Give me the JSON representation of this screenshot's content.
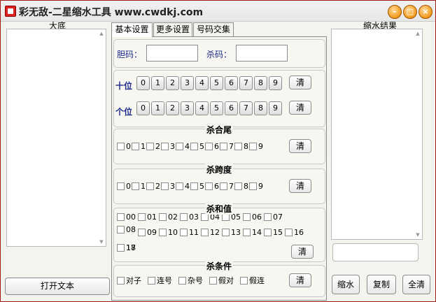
{
  "window": {
    "title": "彩无敌-二星缩水工具 www.cwdkj.com"
  },
  "left_panel": {
    "title": "大底",
    "open_button": "打开文本"
  },
  "tabs": [
    "基本设置",
    "更多设置",
    "号码交集"
  ],
  "basic": {
    "dan_label": "胆码：",
    "sha_label": "杀码：",
    "ten_label": "十位",
    "one_label": "个位",
    "digits": [
      "0",
      "1",
      "2",
      "3",
      "4",
      "5",
      "6",
      "7",
      "8",
      "9"
    ],
    "clear": "清"
  },
  "groups": {
    "tail": {
      "title": "杀合尾",
      "options": [
        "0",
        "1",
        "2",
        "3",
        "4",
        "5",
        "6",
        "7",
        "8",
        "9"
      ]
    },
    "span": {
      "title": "杀跨度",
      "options": [
        "0",
        "1",
        "2",
        "3",
        "4",
        "5",
        "6",
        "7",
        "8",
        "9"
      ]
    },
    "sum": {
      "title": "杀和值",
      "options": [
        "00",
        "01",
        "02",
        "03",
        "04",
        "05",
        "06",
        "07",
        "08",
        "09",
        "10",
        "11",
        "12",
        "13",
        "14",
        "15",
        "16",
        "17",
        "18"
      ]
    },
    "cond": {
      "title": "杀条件",
      "options": [
        "对子",
        "连号",
        "杂号",
        "假对",
        "假连"
      ]
    }
  },
  "right_panel": {
    "title": "缩水结果",
    "shrink": "缩水",
    "copy": "复制",
    "clear_all": "全清"
  },
  "colors": {
    "frame": "#a01818",
    "label_blue": "#1c2a8a",
    "title_button": "#f39a1a"
  }
}
